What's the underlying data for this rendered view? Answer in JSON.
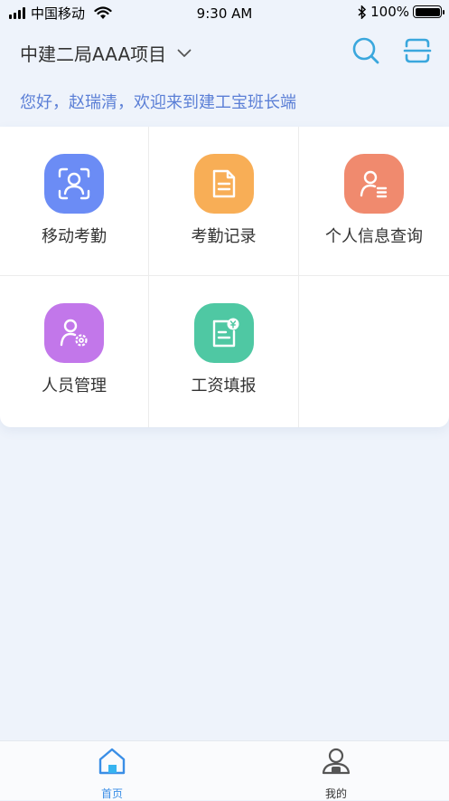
{
  "status_bar": {
    "carrier": "中国移动",
    "time": "9:30 AM",
    "battery": "100%",
    "battery_level": 1.0
  },
  "header": {
    "project_name": "中建二局AAA项目",
    "search_icon": "search-icon",
    "scan_icon": "scan-icon",
    "accent_color": "#3aa7dd"
  },
  "greeting": "您好，赵瑞清，欢迎来到建工宝班长端",
  "grid": {
    "items": [
      {
        "label": "移动考勤",
        "icon": "face-scan-icon",
        "color": "#6b8cf5"
      },
      {
        "label": "考勤记录",
        "icon": "document-icon",
        "color": "#f8ae56"
      },
      {
        "label": "个人信息查询",
        "icon": "person-info-icon",
        "color": "#f08a6e"
      },
      {
        "label": "人员管理",
        "icon": "person-settings-icon",
        "color": "#c277ea"
      },
      {
        "label": "工资填报",
        "icon": "salary-icon",
        "color": "#4fc8a3"
      }
    ]
  },
  "tabbar": {
    "tabs": [
      {
        "label": "首页",
        "icon": "home-icon",
        "active": true
      },
      {
        "label": "我的",
        "icon": "user-icon",
        "active": false
      }
    ],
    "active_color": "#3a8ee6"
  }
}
